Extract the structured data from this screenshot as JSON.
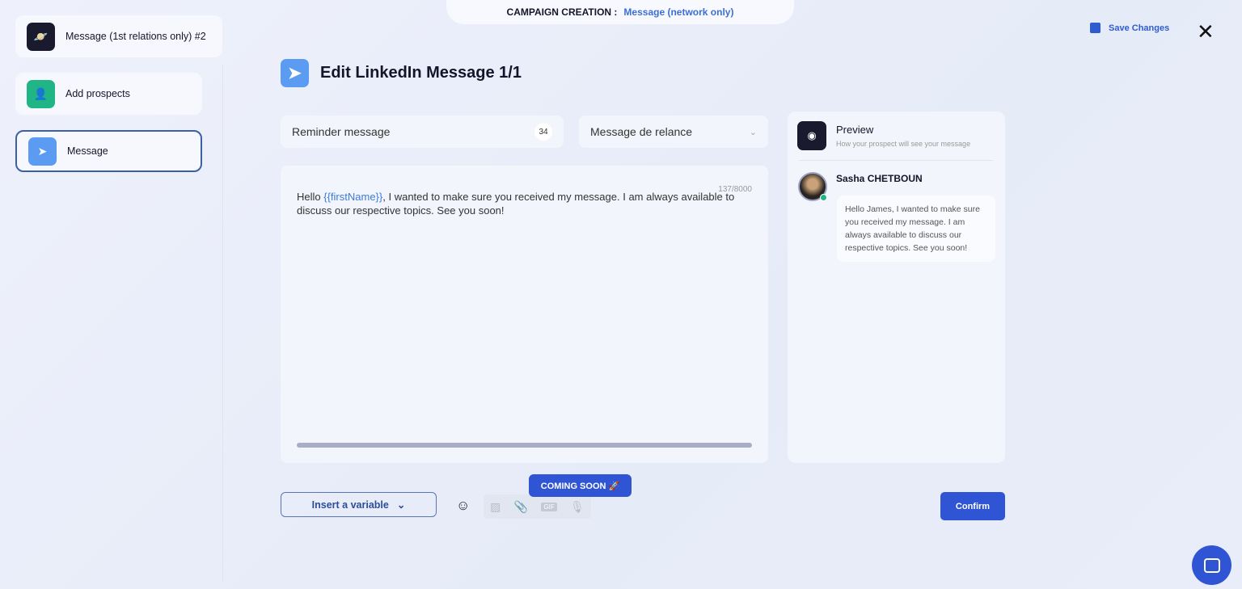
{
  "header": {
    "label": "CAMPAIGN CREATION :",
    "value": "Message (network only)",
    "save_label": "Save Changes",
    "close_icon": "close-icon"
  },
  "sidebar": {
    "items": [
      {
        "label": "Message (1st relations only) #2",
        "icon": "planet-icon",
        "color": "#1a1a2e"
      },
      {
        "label": "Add prospects",
        "icon": "user-plus-icon",
        "color": "#1fb585"
      },
      {
        "label": "Message",
        "icon": "send-icon",
        "color": "#5b9cf2",
        "active": true
      }
    ]
  },
  "main": {
    "title": "Edit LinkedIn Message 1/1",
    "name_field": {
      "value": "Reminder message",
      "count": "34"
    },
    "template_select": {
      "value": "Message de relance"
    },
    "editor": {
      "counter": "137/8000",
      "text_before": "Hello ",
      "variable": "{{firstName}}",
      "text_after": ", I wanted to make sure you received my message. I am always available to discuss our respective topics. See you soon!"
    },
    "insert_variable": "Insert a variable",
    "coming_soon": "COMING SOON 🚀",
    "confirm": "Confirm"
  },
  "preview": {
    "title": "Preview",
    "subtitle": "How your prospect will see your message",
    "sender": "Sasha CHETBOUN",
    "message": "Hello James, I wanted to make sure you received my message. I am always available to discuss our respective topics. See you soon!",
    "status_color": "#1fb585"
  }
}
